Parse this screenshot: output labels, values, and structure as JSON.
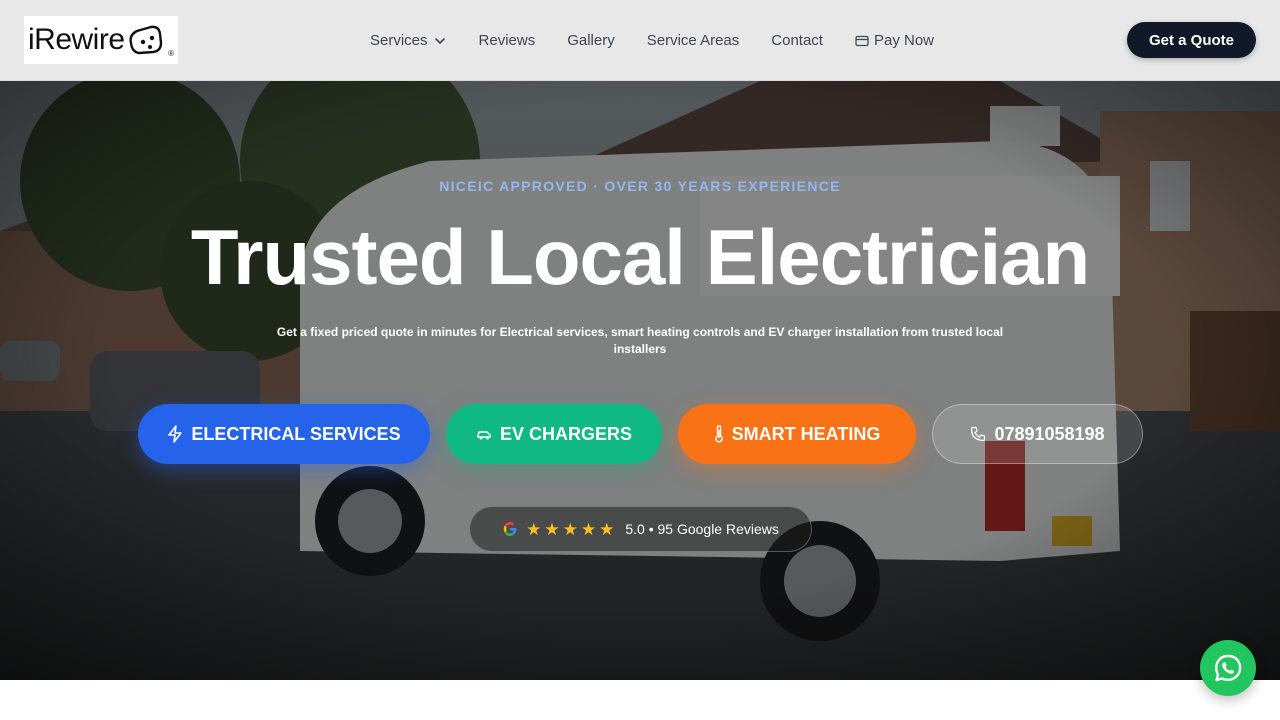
{
  "header": {
    "logo_text": "iRewire",
    "nav": [
      {
        "label": "Services"
      },
      {
        "label": "Reviews"
      },
      {
        "label": "Gallery"
      },
      {
        "label": "Service Areas"
      },
      {
        "label": "Contact"
      },
      {
        "label": "Pay Now"
      }
    ],
    "quote_button": "Get a Quote"
  },
  "hero": {
    "eyebrow": "NICEIC APPROVED · OVER 30 YEARS EXPERIENCE",
    "title": "Trusted Local Electrician",
    "subtitle": "Get a fixed priced quote in minutes for Electrical services, smart heating controls and EV charger installation from trusted local installers",
    "buttons": {
      "electrical": "ELECTRICAL SERVICES",
      "ev": "EV CHARGERS",
      "heating": "SMART HEATING",
      "phone": "07891058198"
    },
    "reviews": {
      "rating_text": "5.0 • 95 Google Reviews",
      "stars": 5
    }
  },
  "icons": {
    "services_chevron": "chevron-down-icon",
    "pay_now": "credit-card-icon",
    "electrical": "lightning-icon",
    "ev": "car-icon",
    "heating": "thermometer-icon",
    "phone": "phone-icon",
    "google": "google-icon",
    "whatsapp": "whatsapp-icon"
  },
  "colors": {
    "electrical": "#2563eb",
    "ev": "#10b981",
    "heating": "#f97316",
    "header_button": "#111827",
    "whatsapp": "#22c55e",
    "star": "#fbbf24",
    "eyebrow": "#93b8f0"
  }
}
